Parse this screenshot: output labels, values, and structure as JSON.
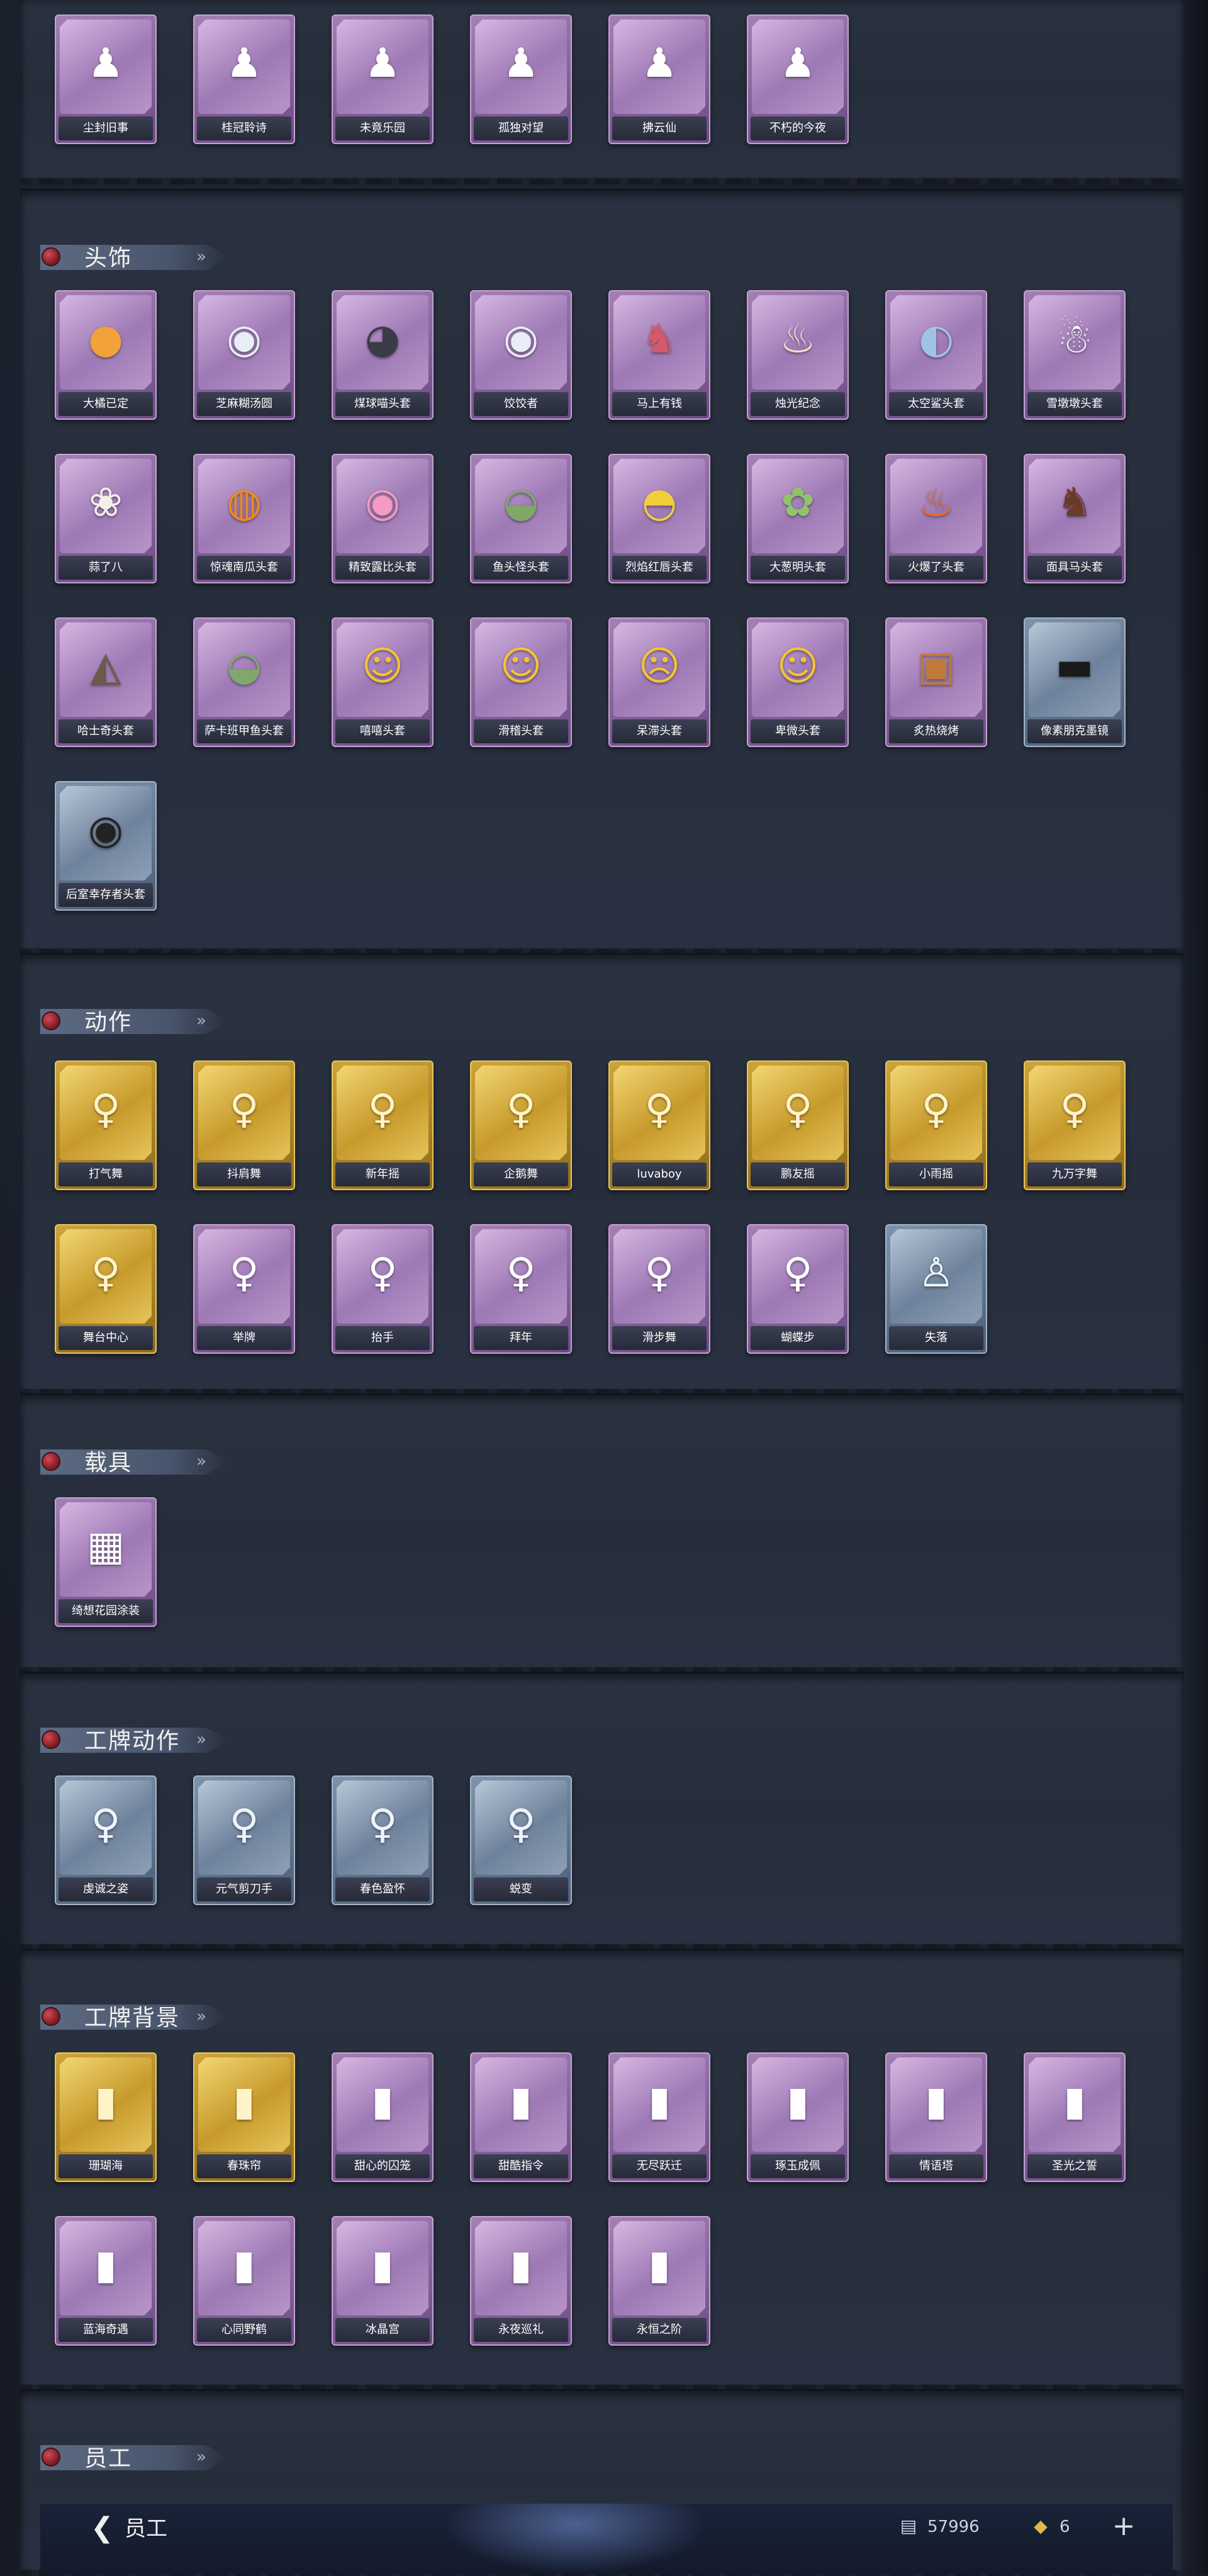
{
  "sections": [
    {
      "title": "",
      "rows": [
        [
          {
            "label": "尘封旧事",
            "tier": "purple",
            "icon": "figure-icon"
          },
          {
            "label": "桂冠聆诗",
            "tier": "purple",
            "icon": "figure-icon"
          },
          {
            "label": "未竟乐园",
            "tier": "purple",
            "icon": "figure-icon"
          },
          {
            "label": "孤独对望",
            "tier": "purple",
            "icon": "figure-icon"
          },
          {
            "label": "拂云仙",
            "tier": "purple",
            "icon": "figure-icon"
          },
          {
            "label": "不朽的今夜",
            "tier": "purple",
            "icon": "figure-icon"
          }
        ]
      ]
    },
    {
      "title": "头饰",
      "rows": [
        [
          {
            "label": "大橘已定",
            "tier": "purple",
            "icon": "orange-head-icon"
          },
          {
            "label": "芝麻糊汤圆",
            "tier": "purple",
            "icon": "dumpling-head-icon"
          },
          {
            "label": "煤球喵头套",
            "tier": "purple",
            "icon": "black-cat-head-icon"
          },
          {
            "label": "饺饺者",
            "tier": "purple",
            "icon": "dumpling-head-icon"
          },
          {
            "label": "马上有钱",
            "tier": "purple",
            "icon": "horse-head-icon"
          },
          {
            "label": "烛光纪念",
            "tier": "purple",
            "icon": "candle-head-icon"
          },
          {
            "label": "太空鲨头套",
            "tier": "purple",
            "icon": "shark-head-icon"
          },
          {
            "label": "雪墩墩头套",
            "tier": "purple",
            "icon": "snowman-head-icon"
          }
        ],
        [
          {
            "label": "蒜了八",
            "tier": "purple",
            "icon": "garlic-head-icon"
          },
          {
            "label": "惊魂南瓜头套",
            "tier": "purple",
            "icon": "pumpkin-head-icon"
          },
          {
            "label": "精致露比头套",
            "tier": "purple",
            "icon": "pink-pig-head-icon"
          },
          {
            "label": "鱼头怪头套",
            "tier": "purple",
            "icon": "fish-head-icon"
          },
          {
            "label": "烈焰红唇头套",
            "tier": "purple",
            "icon": "yellow-mouse-head-icon"
          },
          {
            "label": "大葱明头套",
            "tier": "purple",
            "icon": "scallion-head-icon"
          },
          {
            "label": "火爆了头套",
            "tier": "purple",
            "icon": "fire-head-icon"
          },
          {
            "label": "面具马头套",
            "tier": "purple",
            "icon": "horse-mask-icon"
          }
        ],
        [
          {
            "label": "哈士奇头套",
            "tier": "purple",
            "icon": "husky-head-icon"
          },
          {
            "label": "萨卡班甲鱼头套",
            "tier": "purple",
            "icon": "fish-head-icon"
          },
          {
            "label": "嘻嘻头套",
            "tier": "purple",
            "icon": "grin-face-icon"
          },
          {
            "label": "滑稽头套",
            "tier": "purple",
            "icon": "smirk-face-icon"
          },
          {
            "label": "呆滞头套",
            "tier": "purple",
            "icon": "blank-face-icon"
          },
          {
            "label": "卑微头套",
            "tier": "purple",
            "icon": "humble-face-icon"
          },
          {
            "label": "炙热烧烤",
            "tier": "purple",
            "icon": "bbq-head-icon"
          },
          {
            "label": "像素朋克墨镜",
            "tier": "blue",
            "icon": "pixel-sunglasses-icon"
          }
        ],
        [
          {
            "label": "后室幸存者头套",
            "tier": "blue",
            "icon": "helmet-icon"
          }
        ]
      ]
    },
    {
      "title": "动作",
      "rows": [
        [
          {
            "label": "打气舞",
            "tier": "gold",
            "icon": "dancer-icon"
          },
          {
            "label": "抖肩舞",
            "tier": "gold",
            "icon": "dancer-icon"
          },
          {
            "label": "新年摇",
            "tier": "gold",
            "icon": "dancer-icon"
          },
          {
            "label": "企鹅舞",
            "tier": "gold",
            "icon": "dancer-icon"
          },
          {
            "label": "luvaboy",
            "tier": "gold",
            "icon": "dancer-icon"
          },
          {
            "label": "鹏友摇",
            "tier": "gold",
            "icon": "dancer-icon"
          },
          {
            "label": "小雨摇",
            "tier": "gold",
            "icon": "dancer-icon"
          },
          {
            "label": "九万字舞",
            "tier": "gold",
            "icon": "dancer-icon"
          }
        ],
        [
          {
            "label": "舞台中心",
            "tier": "gold",
            "icon": "dancer-icon"
          },
          {
            "label": "举牌",
            "tier": "purple",
            "icon": "dancer-icon"
          },
          {
            "label": "抬手",
            "tier": "purple",
            "icon": "dancer-icon"
          },
          {
            "label": "拜年",
            "tier": "purple",
            "icon": "dancer-icon"
          },
          {
            "label": "滑步舞",
            "tier": "purple",
            "icon": "dancer-icon"
          },
          {
            "label": "蝴蝶步",
            "tier": "purple",
            "icon": "dancer-icon"
          },
          {
            "label": "失落",
            "tier": "blue",
            "icon": "crawl-icon"
          }
        ]
      ]
    },
    {
      "title": "载具",
      "rows": [
        [
          {
            "label": "绮想花园涂装",
            "tier": "purple",
            "icon": "vehicle-icon"
          }
        ]
      ]
    },
    {
      "title": "工牌动作",
      "rows": [
        [
          {
            "label": "虔诚之姿",
            "tier": "blue",
            "icon": "badge-pose-icon"
          },
          {
            "label": "元气剪刀手",
            "tier": "blue",
            "icon": "badge-pose-icon"
          },
          {
            "label": "春色盈怀",
            "tier": "blue",
            "icon": "badge-pose-icon"
          },
          {
            "label": "蜕变",
            "tier": "blue",
            "icon": "badge-pose-icon"
          }
        ]
      ]
    },
    {
      "title": "工牌背景",
      "rows": [
        [
          {
            "label": "珊瑚海",
            "tier": "gold",
            "icon": "card-art-icon"
          },
          {
            "label": "春珠帘",
            "tier": "gold",
            "icon": "card-art-icon"
          },
          {
            "label": "甜心的囚笼",
            "tier": "purple",
            "icon": "card-art-icon"
          },
          {
            "label": "甜酷指令",
            "tier": "purple",
            "icon": "card-art-icon"
          },
          {
            "label": "无尽跃迁",
            "tier": "purple",
            "icon": "card-art-icon"
          },
          {
            "label": "琢玉成佩",
            "tier": "purple",
            "icon": "card-art-icon"
          },
          {
            "label": "情语塔",
            "tier": "purple",
            "icon": "card-art-icon"
          },
          {
            "label": "圣光之誓",
            "tier": "purple",
            "icon": "card-art-icon"
          }
        ],
        [
          {
            "label": "蓝海奇遇",
            "tier": "purple",
            "icon": "card-art-icon"
          },
          {
            "label": "心同野鹤",
            "tier": "purple",
            "icon": "card-art-icon"
          },
          {
            "label": "冰晶宫",
            "tier": "purple",
            "icon": "card-art-icon"
          },
          {
            "label": "永夜巡礼",
            "tier": "purple",
            "icon": "card-art-icon"
          },
          {
            "label": "永恒之阶",
            "tier": "purple",
            "icon": "card-art-icon"
          }
        ]
      ]
    },
    {
      "title": "员工",
      "rows": []
    }
  ],
  "bottom_bar": {
    "back_label": "员工",
    "currency_1": "57996",
    "currency_2": "6",
    "plus": "+"
  }
}
